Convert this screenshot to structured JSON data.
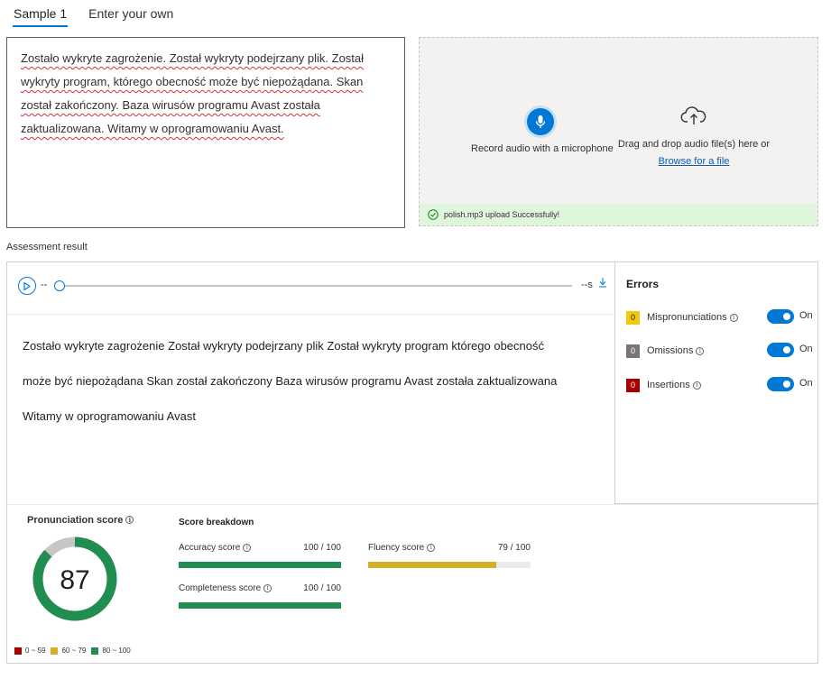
{
  "tabs": [
    {
      "label": "Sample 1",
      "active": true
    },
    {
      "label": "Enter your own",
      "active": false
    }
  ],
  "sample_text": "Zostało wykryte zagrożenie. Został wykryty podejrzany plik. Został wykryty program, którego obecność może być niepożądana. Skan został zakończony. Baza wirusów programu Avast została zaktualizowana. Witamy w oprogramowaniu Avast.",
  "upload": {
    "record_label": "Record audio with a microphone",
    "drop_label": "Drag and drop audio file(s) here or",
    "browse_label": "Browse for a file",
    "status_text": "polish.mp3 upload Successfully!"
  },
  "assessment_label": "Assessment result",
  "player": {
    "time_left": "--",
    "time_right": "--s",
    "progress": 0
  },
  "transcript_lines": [
    "Zostało wykryte zagrożenie Został wykryty podejrzany plik Został wykryty program którego obecność",
    "może być niepożądana Skan został zakończony Baza wirusów programu Avast została zaktualizowana",
    "Witamy w oprogramowaniu Avast"
  ],
  "errors": {
    "title": "Errors",
    "items": [
      {
        "count": "0",
        "label": "Mispronunciations",
        "color": "#f2c811",
        "text_color": "#201f1e",
        "toggle_label": "On",
        "enabled": true
      },
      {
        "count": "0",
        "label": "Omissions",
        "color": "#7a7574",
        "text_color": "#ffffff",
        "toggle_label": "On",
        "enabled": true
      },
      {
        "count": "0",
        "label": "Insertions",
        "color": "#a80000",
        "text_color": "#ffffff",
        "toggle_label": "On",
        "enabled": true
      }
    ]
  },
  "pronunciation": {
    "title": "Pronunciation score",
    "score": "87",
    "score_value": 87,
    "ring_color": "#218d51",
    "ring_bg": "#c8c6c4"
  },
  "legend": [
    {
      "label": "0 ~ 59",
      "color": "#a80000"
    },
    {
      "label": "60 ~ 79",
      "color": "#d4b02a"
    },
    {
      "label": "80 ~ 100",
      "color": "#218d51"
    }
  ],
  "breakdown": {
    "title": "Score breakdown",
    "metrics": [
      {
        "label": "Accuracy score",
        "value": "100 / 100",
        "score": 100,
        "color": "#218d51"
      },
      {
        "label": "Fluency score",
        "value": "79 / 100",
        "score": 79,
        "color": "#d4b02a"
      },
      {
        "label": "Completeness score",
        "value": "100 / 100",
        "score": 100,
        "color": "#218d51"
      }
    ]
  },
  "colors": {
    "accent": "#0078d4",
    "success_bg": "#dff6dd"
  }
}
